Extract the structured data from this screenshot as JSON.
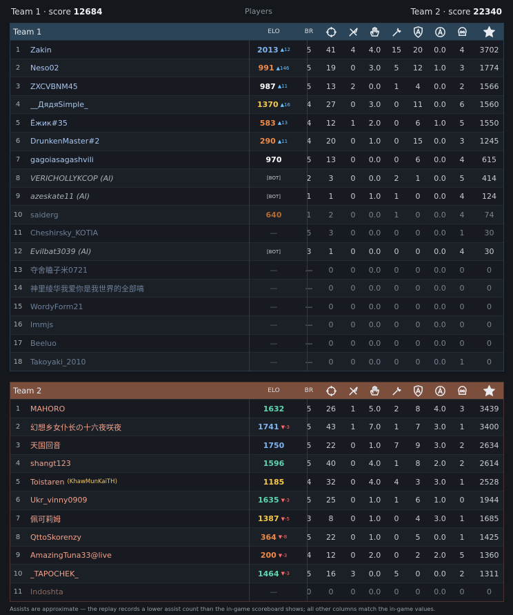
{
  "top": {
    "team1": "Team 1 · score ",
    "team1_score": "12684",
    "center": "Players",
    "team2": "Team 2 · score ",
    "team2_score": "22340"
  },
  "colors": {
    "team1_header": "#2b4457",
    "team2_header": "#7c4e3c",
    "row_dark": "#171b21",
    "row_alt": "#1b2027",
    "team1_name": "#a8c4ec",
    "team2_name": "#f0a08a",
    "elo_blue": "#7fb4ee",
    "elo_orange": "#f08a48",
    "elo_white": "#ffffff",
    "elo_yellow": "#f5c84a",
    "elo_green": "#5fd6b0",
    "elo_brown": "#b06a30",
    "delta_up": "#6ac0ff",
    "delta_down": "#ff6a6a"
  },
  "columns": [
    "ELO",
    "BR",
    "crosshair-icon",
    "knife-icon",
    "hand-icon",
    "wrench-icon",
    "shield-a-icon",
    "circle-a-icon",
    "skull-icon",
    "star-icon"
  ],
  "team1": {
    "title": "Team 1",
    "rows": [
      {
        "n": "1",
        "name": "Zakin",
        "elo": "2013",
        "d": "▲12",
        "ec": "elo_blue",
        "br": "5",
        "k": "41",
        "kn": "4",
        "a": "4.0",
        "r": "15",
        "sa": "20",
        "ca": "0.0",
        "sk": "4",
        "s": "3702",
        "dim": false,
        "ai": false
      },
      {
        "n": "2",
        "name": "Neso02",
        "elo": "991",
        "d": "▲146",
        "ec": "elo_orange",
        "br": "5",
        "k": "19",
        "kn": "0",
        "a": "3.0",
        "r": "5",
        "sa": "12",
        "ca": "1.0",
        "sk": "3",
        "s": "1774",
        "dim": false,
        "ai": false
      },
      {
        "n": "3",
        "name": "ZXCVBNM45",
        "elo": "987",
        "d": "▲11",
        "ec": "elo_white",
        "br": "5",
        "k": "13",
        "kn": "2",
        "a": "0.0",
        "r": "1",
        "sa": "4",
        "ca": "0.0",
        "sk": "2",
        "s": "1566",
        "dim": false,
        "ai": false
      },
      {
        "n": "4",
        "name": "__ДядяSimple_",
        "elo": "1370",
        "d": "▲16",
        "ec": "elo_yellow",
        "br": "4",
        "k": "27",
        "kn": "0",
        "a": "3.0",
        "r": "0",
        "sa": "11",
        "ca": "0.0",
        "sk": "6",
        "s": "1560",
        "dim": false,
        "ai": false
      },
      {
        "n": "5",
        "name": "Ёжик#35",
        "elo": "583",
        "d": "▲13",
        "ec": "elo_orange",
        "br": "4",
        "k": "12",
        "kn": "1",
        "a": "2.0",
        "r": "0",
        "sa": "6",
        "ca": "1.0",
        "sk": "5",
        "s": "1550",
        "dim": false,
        "ai": false
      },
      {
        "n": "6",
        "name": "DrunkenMaster#2",
        "elo": "290",
        "d": "▲11",
        "ec": "elo_orange",
        "br": "4",
        "k": "20",
        "kn": "0",
        "a": "1.0",
        "r": "0",
        "sa": "15",
        "ca": "0.0",
        "sk": "3",
        "s": "1245",
        "dim": false,
        "ai": false
      },
      {
        "n": "7",
        "name": "gagoiasagashvili",
        "elo": "970",
        "d": "",
        "ec": "elo_white",
        "br": "5",
        "k": "13",
        "kn": "0",
        "a": "0.0",
        "r": "0",
        "sa": "6",
        "ca": "0.0",
        "sk": "4",
        "s": "615",
        "dim": false,
        "ai": false
      },
      {
        "n": "8",
        "name": "VERICHOLLYKCOP (AI)",
        "elo": "[BOT]",
        "d": "",
        "ec": "bot",
        "br": "2",
        "k": "3",
        "kn": "0",
        "a": "0.0",
        "r": "2",
        "sa": "1",
        "ca": "0.0",
        "sk": "5",
        "s": "414",
        "dim": false,
        "ai": true
      },
      {
        "n": "9",
        "name": "azeskate11 (AI)",
        "elo": "[BOT]",
        "d": "",
        "ec": "bot",
        "br": "1",
        "k": "1",
        "kn": "0",
        "a": "1.0",
        "r": "1",
        "sa": "0",
        "ca": "0.0",
        "sk": "4",
        "s": "124",
        "dim": false,
        "ai": true
      },
      {
        "n": "10",
        "name": "saiderg",
        "elo": "640",
        "d": "",
        "ec": "elo_brown",
        "br": "1",
        "k": "2",
        "kn": "0",
        "a": "0.0",
        "r": "1",
        "sa": "0",
        "ca": "0.0",
        "sk": "4",
        "s": "74",
        "dim": true,
        "ai": false
      },
      {
        "n": "11",
        "name": "Cheshirsky_KOTIA",
        "elo": "—",
        "d": "",
        "ec": "dash",
        "br": "5",
        "k": "3",
        "kn": "0",
        "a": "0.0",
        "r": "0",
        "sa": "0",
        "ca": "0.0",
        "sk": "1",
        "s": "30",
        "dim": true,
        "ai": false
      },
      {
        "n": "12",
        "name": "Evilbat3039 (AI)",
        "elo": "[BOT]",
        "d": "",
        "ec": "bot",
        "br": "3",
        "k": "1",
        "kn": "0",
        "a": "0.0",
        "r": "0",
        "sa": "0",
        "ca": "0.0",
        "sk": "4",
        "s": "30",
        "dim": false,
        "ai": true
      },
      {
        "n": "13",
        "name": "夺舍瞌子米0721",
        "elo": "—",
        "d": "",
        "ec": "dash",
        "br": "—",
        "k": "0",
        "kn": "0",
        "a": "0.0",
        "r": "0",
        "sa": "0",
        "ca": "0.0",
        "sk": "0",
        "s": "0",
        "dim": true,
        "ai": false
      },
      {
        "n": "14",
        "name": "神里绫华我爱你是我世界的全部嗃",
        "elo": "—",
        "d": "",
        "ec": "dash",
        "br": "—",
        "k": "0",
        "kn": "0",
        "a": "0.0",
        "r": "0",
        "sa": "0",
        "ca": "0.0",
        "sk": "0",
        "s": "0",
        "dim": true,
        "ai": false
      },
      {
        "n": "15",
        "name": "WordyForm21",
        "elo": "—",
        "d": "",
        "ec": "dash",
        "br": "—",
        "k": "0",
        "kn": "0",
        "a": "0.0",
        "r": "0",
        "sa": "0",
        "ca": "0.0",
        "sk": "0",
        "s": "0",
        "dim": true,
        "ai": false
      },
      {
        "n": "16",
        "name": "lmmjs",
        "elo": "—",
        "d": "",
        "ec": "dash",
        "br": "—",
        "k": "0",
        "kn": "0",
        "a": "0.0",
        "r": "0",
        "sa": "0",
        "ca": "0.0",
        "sk": "0",
        "s": "0",
        "dim": true,
        "ai": false
      },
      {
        "n": "17",
        "name": "Beeluo",
        "elo": "—",
        "d": "",
        "ec": "dash",
        "br": "—",
        "k": "0",
        "kn": "0",
        "a": "0.0",
        "r": "0",
        "sa": "0",
        "ca": "0.0",
        "sk": "0",
        "s": "0",
        "dim": true,
        "ai": false
      },
      {
        "n": "18",
        "name": "Takoyaki_2010",
        "elo": "—",
        "d": "",
        "ec": "dash",
        "br": "—",
        "k": "0",
        "kn": "0",
        "a": "0.0",
        "r": "0",
        "sa": "0",
        "ca": "0.0",
        "sk": "1",
        "s": "0",
        "dim": true,
        "ai": false
      }
    ]
  },
  "team2": {
    "title": "Team 2",
    "rows": [
      {
        "n": "1",
        "name": "MAHORO",
        "elo": "1632",
        "d": "",
        "ec": "elo_green",
        "br": "5",
        "k": "26",
        "kn": "1",
        "a": "5.0",
        "r": "2",
        "sa": "8",
        "ca": "4.0",
        "sk": "3",
        "s": "3439",
        "dim": false
      },
      {
        "n": "2",
        "name": "幻想乡女仆长の十六夜咲夜",
        "elo": "1741",
        "d": "▼-3",
        "ec": "elo_blue",
        "br": "5",
        "k": "43",
        "kn": "1",
        "a": "7.0",
        "r": "1",
        "sa": "7",
        "ca": "3.0",
        "sk": "1",
        "s": "3400",
        "dim": false
      },
      {
        "n": "3",
        "name": "天国回音",
        "elo": "1750",
        "d": "",
        "ec": "elo_blue",
        "br": "5",
        "k": "22",
        "kn": "0",
        "a": "1.0",
        "r": "7",
        "sa": "9",
        "ca": "3.0",
        "sk": "2",
        "s": "2634",
        "dim": false
      },
      {
        "n": "4",
        "name": "shangt123",
        "elo": "1596",
        "d": "",
        "ec": "elo_green",
        "br": "5",
        "k": "40",
        "kn": "0",
        "a": "4.0",
        "r": "1",
        "sa": "8",
        "ca": "2.0",
        "sk": "2",
        "s": "2614",
        "dim": false
      },
      {
        "n": "5",
        "name": "Toistaren",
        "tag": "(KhawMunKaiTH)",
        "elo": "1185",
        "d": "",
        "ec": "elo_yellow",
        "br": "4",
        "k": "32",
        "kn": "0",
        "a": "4.0",
        "r": "4",
        "sa": "3",
        "ca": "3.0",
        "sk": "1",
        "s": "2528",
        "dim": false
      },
      {
        "n": "6",
        "name": "Ukr_vinny0909",
        "elo": "1635",
        "d": "▼-3",
        "ec": "elo_green",
        "br": "5",
        "k": "25",
        "kn": "0",
        "a": "1.0",
        "r": "1",
        "sa": "6",
        "ca": "1.0",
        "sk": "0",
        "s": "1944",
        "dim": false
      },
      {
        "n": "7",
        "name": "佩可莉姆",
        "elo": "1387",
        "d": "▼-5",
        "ec": "elo_yellow",
        "br": "3",
        "k": "8",
        "kn": "0",
        "a": "1.0",
        "r": "0",
        "sa": "4",
        "ca": "3.0",
        "sk": "1",
        "s": "1685",
        "dim": false
      },
      {
        "n": "8",
        "name": "QttoSkorenzy",
        "elo": "364",
        "d": "▼-8",
        "ec": "elo_orange",
        "br": "5",
        "k": "22",
        "kn": "0",
        "a": "1.0",
        "r": "0",
        "sa": "5",
        "ca": "0.0",
        "sk": "1",
        "s": "1425",
        "dim": false
      },
      {
        "n": "9",
        "name": "AmazingTuna33@live",
        "elo": "200",
        "d": "▼-3",
        "ec": "elo_orange",
        "br": "4",
        "k": "12",
        "kn": "0",
        "a": "2.0",
        "r": "0",
        "sa": "2",
        "ca": "2.0",
        "sk": "5",
        "s": "1360",
        "dim": false
      },
      {
        "n": "10",
        "name": "_TAPOCHEK_",
        "elo": "1464",
        "d": "▼-3",
        "ec": "elo_green",
        "br": "5",
        "k": "16",
        "kn": "3",
        "a": "0.0",
        "r": "5",
        "sa": "0",
        "ca": "0.0",
        "sk": "2",
        "s": "1311",
        "dim": false
      },
      {
        "n": "11",
        "name": "Indoshta",
        "elo": "—",
        "d": "",
        "ec": "dash",
        "br": "0",
        "k": "0",
        "kn": "0",
        "a": "0.0",
        "r": "0",
        "sa": "0",
        "ca": "0.0",
        "sk": "0",
        "s": "0",
        "dim": true
      }
    ]
  },
  "footnote": "Assists are approximate — the replay records a lower assist count than the in-game scoreboard shows; all other columns match the in-game values."
}
